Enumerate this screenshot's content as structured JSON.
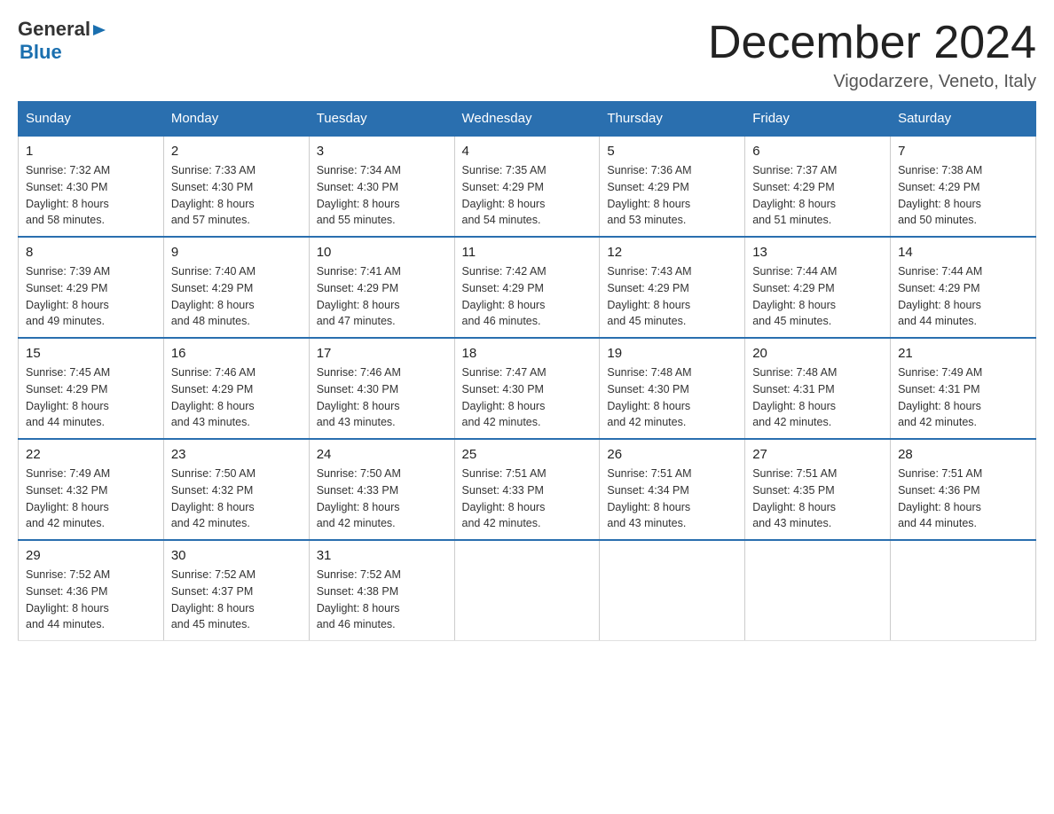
{
  "header": {
    "logo_general": "General",
    "logo_blue": "Blue",
    "month_title": "December 2024",
    "location": "Vigodarzere, Veneto, Italy"
  },
  "days_of_week": [
    "Sunday",
    "Monday",
    "Tuesday",
    "Wednesday",
    "Thursday",
    "Friday",
    "Saturday"
  ],
  "weeks": [
    [
      {
        "day": "1",
        "sunrise": "7:32 AM",
        "sunset": "4:30 PM",
        "daylight": "8 hours and 58 minutes."
      },
      {
        "day": "2",
        "sunrise": "7:33 AM",
        "sunset": "4:30 PM",
        "daylight": "8 hours and 57 minutes."
      },
      {
        "day": "3",
        "sunrise": "7:34 AM",
        "sunset": "4:30 PM",
        "daylight": "8 hours and 55 minutes."
      },
      {
        "day": "4",
        "sunrise": "7:35 AM",
        "sunset": "4:29 PM",
        "daylight": "8 hours and 54 minutes."
      },
      {
        "day": "5",
        "sunrise": "7:36 AM",
        "sunset": "4:29 PM",
        "daylight": "8 hours and 53 minutes."
      },
      {
        "day": "6",
        "sunrise": "7:37 AM",
        "sunset": "4:29 PM",
        "daylight": "8 hours and 51 minutes."
      },
      {
        "day": "7",
        "sunrise": "7:38 AM",
        "sunset": "4:29 PM",
        "daylight": "8 hours and 50 minutes."
      }
    ],
    [
      {
        "day": "8",
        "sunrise": "7:39 AM",
        "sunset": "4:29 PM",
        "daylight": "8 hours and 49 minutes."
      },
      {
        "day": "9",
        "sunrise": "7:40 AM",
        "sunset": "4:29 PM",
        "daylight": "8 hours and 48 minutes."
      },
      {
        "day": "10",
        "sunrise": "7:41 AM",
        "sunset": "4:29 PM",
        "daylight": "8 hours and 47 minutes."
      },
      {
        "day": "11",
        "sunrise": "7:42 AM",
        "sunset": "4:29 PM",
        "daylight": "8 hours and 46 minutes."
      },
      {
        "day": "12",
        "sunrise": "7:43 AM",
        "sunset": "4:29 PM",
        "daylight": "8 hours and 45 minutes."
      },
      {
        "day": "13",
        "sunrise": "7:44 AM",
        "sunset": "4:29 PM",
        "daylight": "8 hours and 45 minutes."
      },
      {
        "day": "14",
        "sunrise": "7:44 AM",
        "sunset": "4:29 PM",
        "daylight": "8 hours and 44 minutes."
      }
    ],
    [
      {
        "day": "15",
        "sunrise": "7:45 AM",
        "sunset": "4:29 PM",
        "daylight": "8 hours and 44 minutes."
      },
      {
        "day": "16",
        "sunrise": "7:46 AM",
        "sunset": "4:29 PM",
        "daylight": "8 hours and 43 minutes."
      },
      {
        "day": "17",
        "sunrise": "7:46 AM",
        "sunset": "4:30 PM",
        "daylight": "8 hours and 43 minutes."
      },
      {
        "day": "18",
        "sunrise": "7:47 AM",
        "sunset": "4:30 PM",
        "daylight": "8 hours and 42 minutes."
      },
      {
        "day": "19",
        "sunrise": "7:48 AM",
        "sunset": "4:30 PM",
        "daylight": "8 hours and 42 minutes."
      },
      {
        "day": "20",
        "sunrise": "7:48 AM",
        "sunset": "4:31 PM",
        "daylight": "8 hours and 42 minutes."
      },
      {
        "day": "21",
        "sunrise": "7:49 AM",
        "sunset": "4:31 PM",
        "daylight": "8 hours and 42 minutes."
      }
    ],
    [
      {
        "day": "22",
        "sunrise": "7:49 AM",
        "sunset": "4:32 PM",
        "daylight": "8 hours and 42 minutes."
      },
      {
        "day": "23",
        "sunrise": "7:50 AM",
        "sunset": "4:32 PM",
        "daylight": "8 hours and 42 minutes."
      },
      {
        "day": "24",
        "sunrise": "7:50 AM",
        "sunset": "4:33 PM",
        "daylight": "8 hours and 42 minutes."
      },
      {
        "day": "25",
        "sunrise": "7:51 AM",
        "sunset": "4:33 PM",
        "daylight": "8 hours and 42 minutes."
      },
      {
        "day": "26",
        "sunrise": "7:51 AM",
        "sunset": "4:34 PM",
        "daylight": "8 hours and 43 minutes."
      },
      {
        "day": "27",
        "sunrise": "7:51 AM",
        "sunset": "4:35 PM",
        "daylight": "8 hours and 43 minutes."
      },
      {
        "day": "28",
        "sunrise": "7:51 AM",
        "sunset": "4:36 PM",
        "daylight": "8 hours and 44 minutes."
      }
    ],
    [
      {
        "day": "29",
        "sunrise": "7:52 AM",
        "sunset": "4:36 PM",
        "daylight": "8 hours and 44 minutes."
      },
      {
        "day": "30",
        "sunrise": "7:52 AM",
        "sunset": "4:37 PM",
        "daylight": "8 hours and 45 minutes."
      },
      {
        "day": "31",
        "sunrise": "7:52 AM",
        "sunset": "4:38 PM",
        "daylight": "8 hours and 46 minutes."
      },
      null,
      null,
      null,
      null
    ]
  ],
  "labels": {
    "sunrise": "Sunrise:",
    "sunset": "Sunset:",
    "daylight": "Daylight:"
  }
}
